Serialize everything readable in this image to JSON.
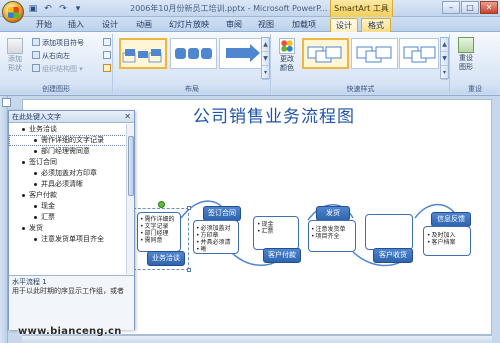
{
  "window": {
    "title": "2006年10月份新员工培训.pptx - Microsoft PowerP...",
    "context_label": "SmartArt 工具"
  },
  "qat": [
    "save-icon",
    "undo-icon",
    "redo-icon",
    "dropdown-icon"
  ],
  "tabs": [
    {
      "label": "开始"
    },
    {
      "label": "插入"
    },
    {
      "label": "设计"
    },
    {
      "label": "动画"
    },
    {
      "label": "幻灯片放映"
    },
    {
      "label": "审阅"
    },
    {
      "label": "视图"
    },
    {
      "label": "加载项"
    },
    {
      "label": "设计"
    },
    {
      "label": "格式"
    }
  ],
  "ribbon": {
    "create_graphic": {
      "label": "创建图形",
      "add_shape": "添加\n形状",
      "add_bullet": "添加项目符号",
      "right_to_left": "从右向左",
      "organization_chart": "组织结构图"
    },
    "layouts": {
      "label": "布局"
    },
    "smartart_styles": {
      "label": "快速样式",
      "change_colors": "更改\n颜色"
    },
    "reset": {
      "label": "重设",
      "reset_graphic": "重设\n图形"
    }
  },
  "slide": {
    "title": "公司销售业务流程图"
  },
  "text_pane": {
    "title": "在此处键入文字",
    "items": [
      {
        "level": 1,
        "text": "业务洽谈"
      },
      {
        "level": 2,
        "text": "需作详细的文字记录",
        "selected": true
      },
      {
        "level": 2,
        "text": "部门经理需同意"
      },
      {
        "level": 1,
        "text": "签订合同"
      },
      {
        "level": 2,
        "text": "必须加盖对方印章"
      },
      {
        "level": 2,
        "text": "并具必须清晰"
      },
      {
        "level": 1,
        "text": "客户付款"
      },
      {
        "level": 2,
        "text": "现金"
      },
      {
        "level": 2,
        "text": "汇票"
      },
      {
        "level": 1,
        "text": "发货"
      },
      {
        "level": 2,
        "text": "注意发货单项目齐全"
      }
    ],
    "desc_title": "水平流程 1",
    "desc_text": "用于以此时期的序显示工作组，或者"
  },
  "diagram": {
    "steps": [
      {
        "head": "业务洽谈",
        "lines": [
          "需作详细的",
          "文字记录",
          "部门经理",
          "需同意"
        ]
      },
      {
        "head": "签订合同",
        "lines": [
          "必须加盖对",
          "方印章",
          "并具必须清",
          "晰"
        ]
      },
      {
        "head": "客户付款",
        "lines": [
          "现金",
          "汇票"
        ]
      },
      {
        "head": "发货",
        "lines": [
          "注意发货单",
          "项目齐全"
        ]
      },
      {
        "head": "客户收货",
        "lines": []
      },
      {
        "head": "信息反馈",
        "lines": [
          "及时加入",
          "客户档案"
        ]
      }
    ]
  },
  "watermark": "www.bianceng.cn"
}
